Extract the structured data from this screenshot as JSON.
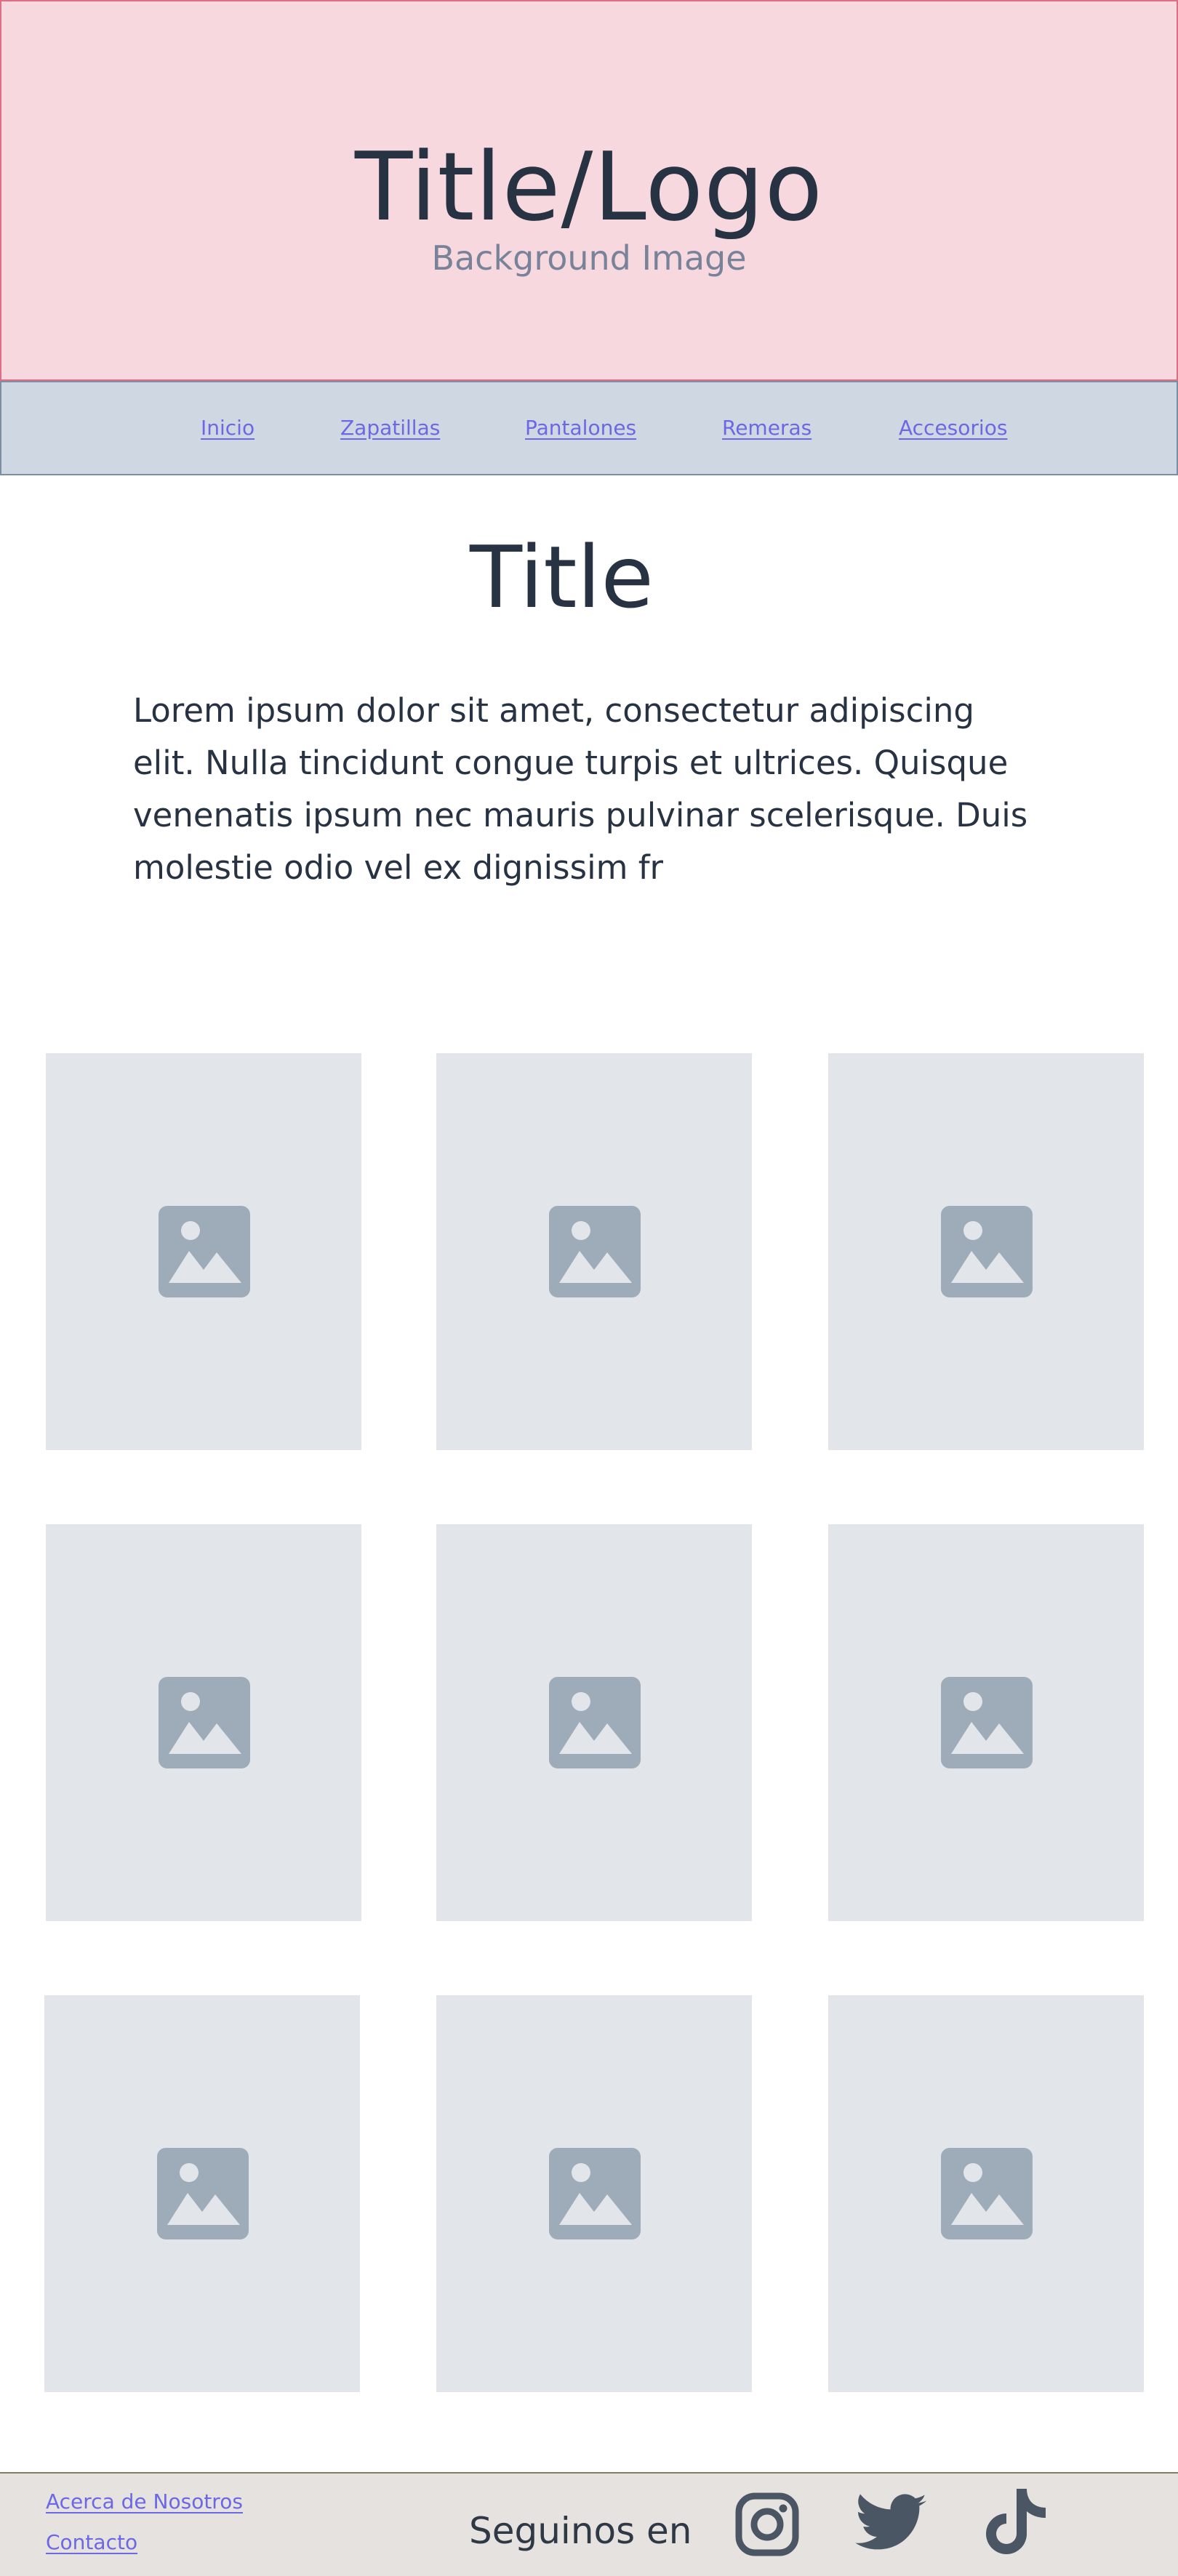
{
  "header": {
    "title": "Title/Logo",
    "subtitle": "Background Image"
  },
  "nav": {
    "items": [
      {
        "label": "Inicio"
      },
      {
        "label": "Zapatillas"
      },
      {
        "label": "Pantalones"
      },
      {
        "label": "Remeras"
      },
      {
        "label": "Accesorios"
      }
    ]
  },
  "main": {
    "title": "Title",
    "body": "Lorem ipsum dolor sit amet, consectetur adipiscing elit. Nulla tincidunt congue turpis et ultrices. Quisque venenatis ipsum nec mauris pulvinar scelerisque. Duis molestie odio vel ex dignissim fr"
  },
  "gallery": {
    "items": [
      {
        "icon": "image-placeholder-icon"
      },
      {
        "icon": "image-placeholder-icon"
      },
      {
        "icon": "image-placeholder-icon"
      },
      {
        "icon": "image-placeholder-icon"
      },
      {
        "icon": "image-placeholder-icon"
      },
      {
        "icon": "image-placeholder-icon"
      },
      {
        "icon": "image-placeholder-icon"
      },
      {
        "icon": "image-placeholder-icon"
      },
      {
        "icon": "image-placeholder-icon"
      }
    ]
  },
  "footer": {
    "links": [
      {
        "label": "Acerca de Nosotros"
      },
      {
        "label": "Contacto"
      }
    ],
    "follow_label": "Seguinos en",
    "socials": [
      {
        "icon": "instagram-icon"
      },
      {
        "icon": "twitter-icon"
      },
      {
        "icon": "tiktok-icon"
      }
    ]
  },
  "colors": {
    "header_bg": "#f6d8de",
    "header_border": "#dc6f86",
    "nav_bg": "#cfd8e2",
    "link": "#6c67e5",
    "text_dark": "#273243",
    "tile_bg": "#e2e6eb",
    "placeholder_icon": "#9eabb8",
    "footer_bg": "#e6e2df",
    "social_icon": "#4a5664"
  }
}
